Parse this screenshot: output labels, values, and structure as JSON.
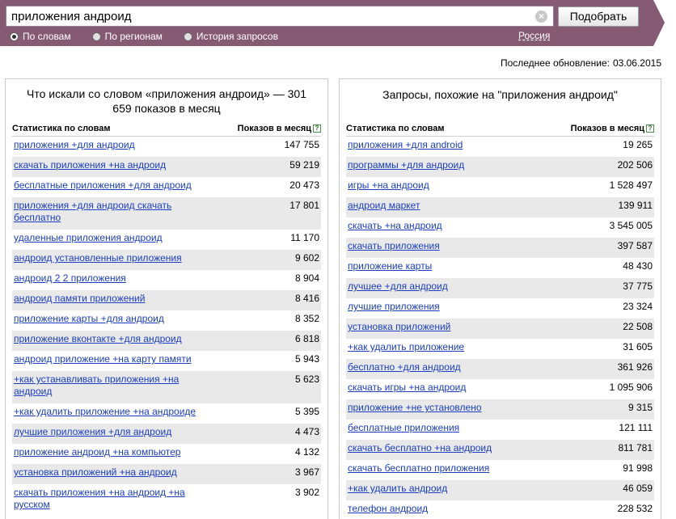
{
  "search": {
    "query": "приложения андроид",
    "button_label": "Подобрать",
    "modes": [
      {
        "label": "По словам",
        "checked": true
      },
      {
        "label": "По регионам",
        "checked": false
      },
      {
        "label": "История запросов",
        "checked": false
      }
    ],
    "region": "Россия"
  },
  "last_update": {
    "label": "Последнее обновление:",
    "date": "03.06.2015"
  },
  "left_panel": {
    "title": "Что искали со словом «приложения андроид» — 301 659 показов в месяц",
    "col_keyword": "Статистика по словам",
    "col_shows": "Показов в месяц",
    "rows": [
      {
        "kw": "приложения +для андроид",
        "n": "147 755"
      },
      {
        "kw": "скачать приложения +на андроид",
        "n": "59 219"
      },
      {
        "kw": "бесплатные приложения +для андроид",
        "n": "20 473"
      },
      {
        "kw": "приложения +для андроид скачать бесплатно",
        "n": "17 801"
      },
      {
        "kw": "удаленные приложения андроид",
        "n": "11 170"
      },
      {
        "kw": "андроид установленные приложения",
        "n": "9 602"
      },
      {
        "kw": "андроид 2 2 приложения",
        "n": "8 904"
      },
      {
        "kw": "андроид памяти приложений",
        "n": "8 416"
      },
      {
        "kw": "приложение карты +для андроид",
        "n": "8 352"
      },
      {
        "kw": "приложение вконтакте +для андроид",
        "n": "6 818"
      },
      {
        "kw": "андроид приложение +на карту памяти",
        "n": "5 943"
      },
      {
        "kw": "+как устанавливать приложения +на андроид",
        "n": "5 623"
      },
      {
        "kw": "+как удалить приложение +на андроиде",
        "n": "5 395"
      },
      {
        "kw": "лучшие приложения +для андроид",
        "n": "4 473"
      },
      {
        "kw": "приложение андроид +на компьютер",
        "n": "4 132"
      },
      {
        "kw": "установка приложений +на андроид",
        "n": "3 967"
      },
      {
        "kw": "скачать приложения +на андроид +на русском",
        "n": "3 902"
      }
    ]
  },
  "right_panel": {
    "title": "Запросы, похожие на \"приложения андроид\"",
    "col_keyword": "Статистика по словам",
    "col_shows": "Показов в месяц",
    "rows": [
      {
        "kw": "приложения +для android",
        "n": "19 265"
      },
      {
        "kw": "программы +для андроид",
        "n": "202 506"
      },
      {
        "kw": "игры +на андроид",
        "n": "1 528 497"
      },
      {
        "kw": "андроид маркет",
        "n": "139 911"
      },
      {
        "kw": "скачать +на андроид",
        "n": "3 545 005"
      },
      {
        "kw": "скачать приложения",
        "n": "397 587"
      },
      {
        "kw": "приложение карты",
        "n": "48 430"
      },
      {
        "kw": "лучшее +для андроид",
        "n": "37 775"
      },
      {
        "kw": "лучшие приложения",
        "n": "23 324"
      },
      {
        "kw": "установка приложений",
        "n": "22 508"
      },
      {
        "kw": "+как удалить приложение",
        "n": "31 605"
      },
      {
        "kw": "бесплатно +для андроид",
        "n": "361 926"
      },
      {
        "kw": "скачать игры +на андроид",
        "n": "1 095 906"
      },
      {
        "kw": "приложение +не установлено",
        "n": "9 315"
      },
      {
        "kw": "бесплатные приложения",
        "n": "121 111"
      },
      {
        "kw": "скачать бесплатно +на андроид",
        "n": "811 781"
      },
      {
        "kw": "скачать бесплатно приложения",
        "n": "91 998"
      },
      {
        "kw": "+как удалить андроид",
        "n": "46 059"
      },
      {
        "kw": "телефон андроид",
        "n": "228 532"
      }
    ]
  },
  "colors": {
    "bar": "#875a73",
    "link": "#1a3dc1",
    "stripe": "#e9e9e9"
  },
  "icons": [
    "clear-icon",
    "help-icon"
  ]
}
